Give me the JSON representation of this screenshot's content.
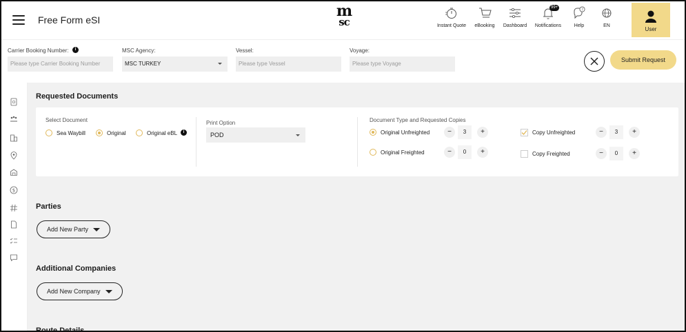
{
  "header": {
    "app_title": "Free Form eSI",
    "logo_top": "m",
    "logo_bottom": "sc",
    "nav": [
      {
        "label": "Instant Quote",
        "icon": "stopwatch-icon"
      },
      {
        "label": "eBooking",
        "icon": "cart-icon"
      },
      {
        "label": "Dashboard",
        "icon": "sliders-icon"
      },
      {
        "label": "Notifications",
        "icon": "bell-icon",
        "badge": "99+"
      },
      {
        "label": "Help",
        "icon": "help-chat-icon"
      },
      {
        "label": "EN",
        "icon": "globe-icon"
      }
    ],
    "user_label": "User"
  },
  "booking_form": {
    "carrier_label": "Carrier Booking Number:",
    "carrier_placeholder": "Please type Carrier Booking Number",
    "agency_label": "MSC Agency:",
    "agency_value": "MSC TURKEY",
    "vessel_label": "Vessel:",
    "vessel_placeholder": "Please type Vessel",
    "voyage_label": "Voyage:",
    "voyage_placeholder": "Please type Voyage",
    "submit_label": "Submit Request"
  },
  "requested_documents": {
    "title": "Requested Documents",
    "select_label": "Select Document",
    "doc_options": [
      {
        "label": "Sea Waybill",
        "selected": false
      },
      {
        "label": "Original",
        "selected": true
      },
      {
        "label": "Original eBL",
        "selected": false
      }
    ],
    "print_label": "Print Option",
    "print_value": "POD",
    "type_label": "Document Type and Requested Copies",
    "types": [
      {
        "label": "Original Unfreighted",
        "selected": true,
        "copies": "3"
      },
      {
        "label": "Original Freighted",
        "selected": false,
        "copies": "0"
      }
    ],
    "copies": [
      {
        "label": "Copy Unfreighted",
        "checked": true,
        "copies": "3"
      },
      {
        "label": "Copy Freighted",
        "checked": false,
        "copies": "0"
      }
    ],
    "minus": "−",
    "plus": "+"
  },
  "parties": {
    "title": "Parties",
    "add_label": "Add New Party"
  },
  "companies": {
    "title": "Additional Companies",
    "add_label": "Add New Company"
  },
  "route": {
    "title": "Route Details"
  },
  "accent_color": "#f2d98a"
}
